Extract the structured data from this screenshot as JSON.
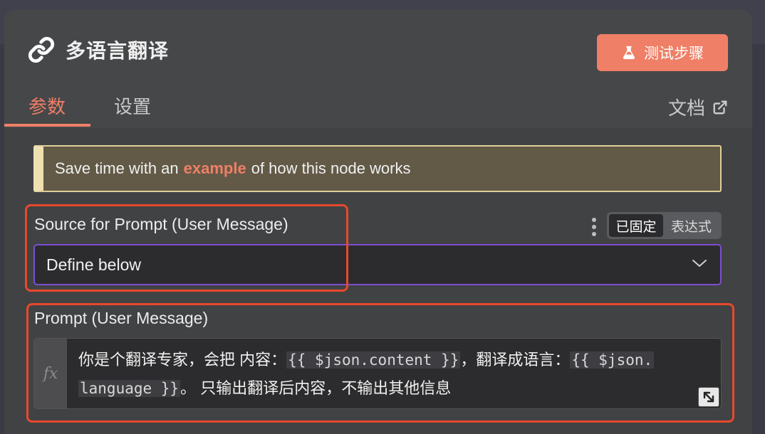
{
  "node": {
    "title": "多语言翻译"
  },
  "header": {
    "test_button": "测试步骤",
    "docs_link": "文档"
  },
  "tabs": [
    {
      "label": "参数",
      "active": true
    },
    {
      "label": "设置",
      "active": false
    }
  ],
  "banner": {
    "before": "Save time with an",
    "link": "example",
    "after": "of how this node works"
  },
  "source_field": {
    "label": "Source for Prompt (User Message)",
    "value": "Define below",
    "mode_fixed": "已固定",
    "mode_expression": "表达式"
  },
  "prompt_field": {
    "label": "Prompt (User Message)",
    "fx_label": "fx",
    "text_1": "你是个翻译专家，会把  内容：",
    "expr_1": "{{ $json.content }}",
    "text_2": "，翻译成语言：",
    "expr_2a": "{{ $json.",
    "expr_2b": "language }}",
    "text_3": "。 只输出翻译后内容，不输出其他信息"
  },
  "colors": {
    "accent": "#ef7f66",
    "highlight": "#e8482c",
    "select_border": "#7a4fd0"
  }
}
